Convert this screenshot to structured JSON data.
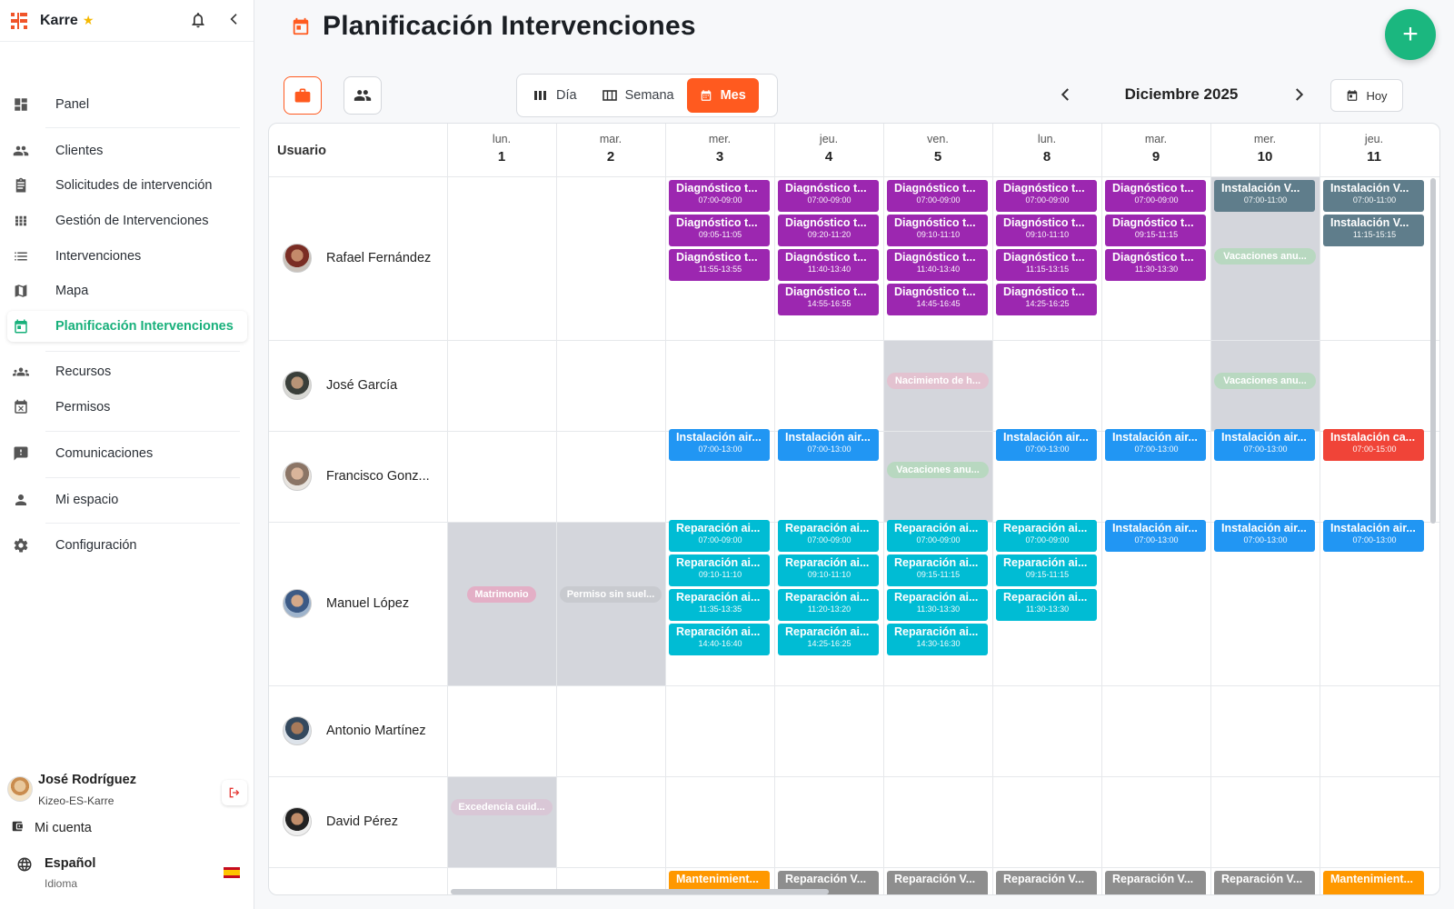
{
  "app": {
    "name": "Karre"
  },
  "sidebar": {
    "items": [
      {
        "label": "Panel",
        "icon": "dashboard-icon"
      },
      {
        "label": "Clientes",
        "icon": "people-icon"
      },
      {
        "label": "Solicitudes de intervención",
        "icon": "clipboard-icon"
      },
      {
        "label": "Gestión de Intervenciones",
        "icon": "grid-icon"
      },
      {
        "label": "Intervenciones",
        "icon": "list-icon"
      },
      {
        "label": "Mapa",
        "icon": "map-icon"
      },
      {
        "label": "Planificación Intervenciones",
        "icon": "calendar-icon",
        "active": true
      },
      {
        "label": "Recursos",
        "icon": "groups-icon"
      },
      {
        "label": "Permisos",
        "icon": "event-busy-icon"
      },
      {
        "label": "Comunicaciones",
        "icon": "feedback-icon"
      },
      {
        "label": "Mi espacio",
        "icon": "person-icon"
      },
      {
        "label": "Configuración",
        "icon": "gear-icon"
      }
    ]
  },
  "user": {
    "name": "José Rodríguez",
    "org": "Kizeo-ES-Karre"
  },
  "account": {
    "label": "Mi cuenta"
  },
  "language": {
    "name": "Español",
    "sub": "Idioma"
  },
  "page": {
    "title": "Planificación Intervenciones"
  },
  "views": {
    "day": "Día",
    "week": "Semana",
    "month": "Mes",
    "selected": "Mes"
  },
  "period": {
    "label": "Diciembre 2025",
    "today": "Hoy"
  },
  "calendar": {
    "user_header": "Usuario",
    "days": [
      {
        "name": "lun.",
        "num": "1"
      },
      {
        "name": "mar.",
        "num": "2"
      },
      {
        "name": "mer.",
        "num": "3"
      },
      {
        "name": "jeu.",
        "num": "4"
      },
      {
        "name": "ven.",
        "num": "5"
      },
      {
        "name": "lun.",
        "num": "8"
      },
      {
        "name": "mar.",
        "num": "9"
      },
      {
        "name": "mer.",
        "num": "10"
      },
      {
        "name": "jeu.",
        "num": "11"
      }
    ],
    "users": [
      "Rafael Fernández",
      "José García",
      "Francisco Gonz...",
      "Manuel López",
      "Antonio Martínez",
      "David Pérez"
    ],
    "colors": {
      "diagnostico": "#9c27b0",
      "instalacion_v": "#5f7d8b",
      "instalacion_air": "#2196f3",
      "instalacion_ca": "#f04438",
      "reparacion_ai": "#00bcd4",
      "reparacion_v": "#8e8e8e",
      "mantenimiento": "#ff9800",
      "absence": "#d4d6dc"
    },
    "absences": [
      {
        "label": "Vacaciones anu...",
        "color": "#b8d8c0"
      },
      {
        "label": "Nacimiento de h...",
        "color": "#e3c2d0"
      },
      {
        "label": "Vacaciones anu...",
        "color": "#b8d8c0"
      },
      {
        "label": "Vacaciones anu...",
        "color": "#b8d8c0"
      },
      {
        "label": "Matrimonio",
        "color": "#e3afc6"
      },
      {
        "label": "Permiso sin suel...",
        "color": "#c8cacf"
      },
      {
        "label": "Excedencia cuid...",
        "color": "#d9c7d6"
      }
    ],
    "events": [
      {
        "title": "Diagnóstico t...",
        "time": "07:00-09:00",
        "type": "diagnostico"
      },
      {
        "title": "Diagnóstico t...",
        "time": "09:05-11:05",
        "type": "diagnostico"
      },
      {
        "title": "Diagnóstico t...",
        "time": "11:55-13:55",
        "type": "diagnostico"
      },
      {
        "title": "Diagnóstico t...",
        "time": "07:00-09:00",
        "type": "diagnostico"
      },
      {
        "title": "Diagnóstico t...",
        "time": "09:20-11:20",
        "type": "diagnostico"
      },
      {
        "title": "Diagnóstico t...",
        "time": "11:40-13:40",
        "type": "diagnostico"
      },
      {
        "title": "Diagnóstico t...",
        "time": "14:55-16:55",
        "type": "diagnostico"
      },
      {
        "title": "Diagnóstico t...",
        "time": "07:00-09:00",
        "type": "diagnostico"
      },
      {
        "title": "Diagnóstico t...",
        "time": "09:10-11:10",
        "type": "diagnostico"
      },
      {
        "title": "Diagnóstico t...",
        "time": "11:40-13:40",
        "type": "diagnostico"
      },
      {
        "title": "Diagnóstico t...",
        "time": "14:45-16:45",
        "type": "diagnostico"
      },
      {
        "title": "Diagnóstico t...",
        "time": "07:00-09:00",
        "type": "diagnostico"
      },
      {
        "title": "Diagnóstico t...",
        "time": "09:10-11:10",
        "type": "diagnostico"
      },
      {
        "title": "Diagnóstico t...",
        "time": "11:15-13:15",
        "type": "diagnostico"
      },
      {
        "title": "Diagnóstico t...",
        "time": "14:25-16:25",
        "type": "diagnostico"
      },
      {
        "title": "Diagnóstico t...",
        "time": "07:00-09:00",
        "type": "diagnostico"
      },
      {
        "title": "Diagnóstico t...",
        "time": "09:15-11:15",
        "type": "diagnostico"
      },
      {
        "title": "Diagnóstico t...",
        "time": "11:30-13:30",
        "type": "diagnostico"
      },
      {
        "title": "Instalación V...",
        "time": "07:00-11:00",
        "type": "instalacion_v"
      },
      {
        "title": "Instalación V...",
        "time": "07:00-11:00",
        "type": "instalacion_v"
      },
      {
        "title": "Instalación V...",
        "time": "11:15-15:15",
        "type": "instalacion_v"
      },
      {
        "title": "Instalación air...",
        "time": "07:00-13:00",
        "type": "instalacion_air"
      },
      {
        "title": "Instalación air...",
        "time": "07:00-13:00",
        "type": "instalacion_air"
      },
      {
        "title": "Instalación air...",
        "time": "07:00-13:00",
        "type": "instalacion_air"
      },
      {
        "title": "Instalación air...",
        "time": "07:00-13:00",
        "type": "instalacion_air"
      },
      {
        "title": "Instalación air...",
        "time": "07:00-13:00",
        "type": "instalacion_air"
      },
      {
        "title": "Instalación ca...",
        "time": "07:00-15:00",
        "type": "instalacion_ca"
      },
      {
        "title": "Reparación ai...",
        "time": "07:00-09:00",
        "type": "reparacion_ai"
      },
      {
        "title": "Reparación ai...",
        "time": "09:10-11:10",
        "type": "reparacion_ai"
      },
      {
        "title": "Reparación ai...",
        "time": "11:35-13:35",
        "type": "reparacion_ai"
      },
      {
        "title": "Reparación ai...",
        "time": "14:40-16:40",
        "type": "reparacion_ai"
      },
      {
        "title": "Reparación ai...",
        "time": "07:00-09:00",
        "type": "reparacion_ai"
      },
      {
        "title": "Reparación ai...",
        "time": "09:10-11:10",
        "type": "reparacion_ai"
      },
      {
        "title": "Reparación ai...",
        "time": "11:20-13:20",
        "type": "reparacion_ai"
      },
      {
        "title": "Reparación ai...",
        "time": "14:25-16:25",
        "type": "reparacion_ai"
      },
      {
        "title": "Reparación ai...",
        "time": "07:00-09:00",
        "type": "reparacion_ai"
      },
      {
        "title": "Reparación ai...",
        "time": "09:15-11:15",
        "type": "reparacion_ai"
      },
      {
        "title": "Reparación ai...",
        "time": "11:30-13:30",
        "type": "reparacion_ai"
      },
      {
        "title": "Reparación ai...",
        "time": "14:30-16:30",
        "type": "reparacion_ai"
      },
      {
        "title": "Reparación ai...",
        "time": "07:00-09:00",
        "type": "reparacion_ai"
      },
      {
        "title": "Reparación ai...",
        "time": "09:15-11:15",
        "type": "reparacion_ai"
      },
      {
        "title": "Reparación ai...",
        "time": "11:30-13:30",
        "type": "reparacion_ai"
      },
      {
        "title": "Instalación air...",
        "time": "07:00-13:00",
        "type": "instalacion_air"
      },
      {
        "title": "Instalación air...",
        "time": "07:00-13:00",
        "type": "instalacion_air"
      },
      {
        "title": "Instalación air...",
        "time": "07:00-13:00",
        "type": "instalacion_air"
      },
      {
        "title": "Mantenimient...",
        "time": "",
        "type": "mantenimiento"
      },
      {
        "title": "Reparación V...",
        "time": "",
        "type": "reparacion_v"
      },
      {
        "title": "Reparación V...",
        "time": "",
        "type": "reparacion_v"
      },
      {
        "title": "Reparación V...",
        "time": "",
        "type": "reparacion_v"
      },
      {
        "title": "Reparación V...",
        "time": "",
        "type": "reparacion_v"
      },
      {
        "title": "Reparación V...",
        "time": "",
        "type": "reparacion_v"
      },
      {
        "title": "Mantenimient...",
        "time": "",
        "type": "mantenimiento"
      }
    ]
  }
}
